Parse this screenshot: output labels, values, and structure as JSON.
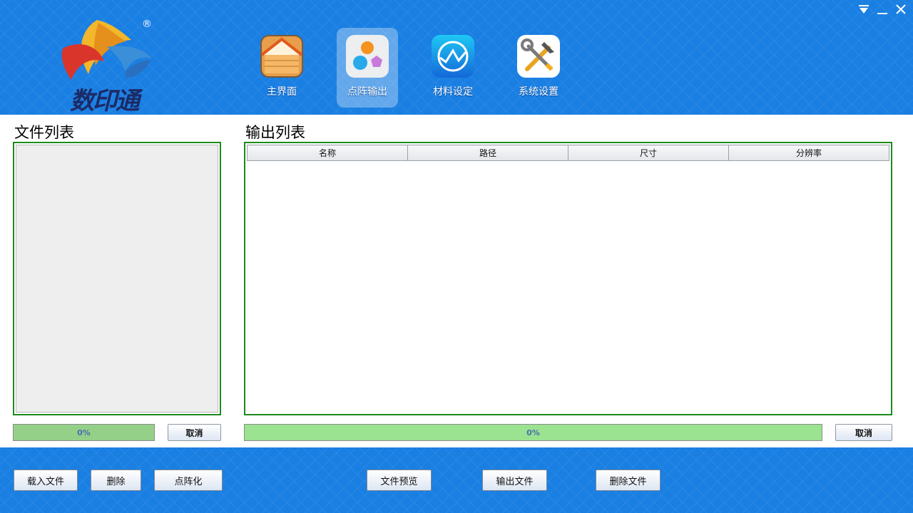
{
  "window_controls": {
    "menu_icon": "dropdown-triangle-icon",
    "minimize_icon": "minimize-icon",
    "close_icon": "close-icon"
  },
  "logo": {
    "text": "数印通",
    "registered_mark": "®"
  },
  "nav": [
    {
      "label": "主界面",
      "icon": "home-icon",
      "active": false
    },
    {
      "label": "点阵输出",
      "icon": "dot-matrix-icon",
      "active": true
    },
    {
      "label": "材料设定",
      "icon": "material-chart-icon",
      "active": false
    },
    {
      "label": "系统设置",
      "icon": "tools-icon",
      "active": false
    }
  ],
  "file_list": {
    "title": "文件列表",
    "progress": {
      "text": "0%",
      "value": 0
    },
    "cancel_label": "取消"
  },
  "output_list": {
    "title": "输出列表",
    "columns": [
      "名称",
      "路径",
      "尺寸",
      "分辨率"
    ],
    "rows": [],
    "progress": {
      "text": "0%",
      "value": 0
    },
    "cancel_label": "取消"
  },
  "footer": {
    "load_file": "载入文件",
    "delete": "删除",
    "dot_matrix": "点阵化",
    "preview": "文件预览",
    "output_file": "输出文件",
    "delete_file": "删除文件"
  },
  "colors": {
    "header_blue": "#1a7fe2",
    "panel_border": "#1d8a1d",
    "progress_green": "#9be390",
    "progress_green_dim": "#95d089"
  }
}
